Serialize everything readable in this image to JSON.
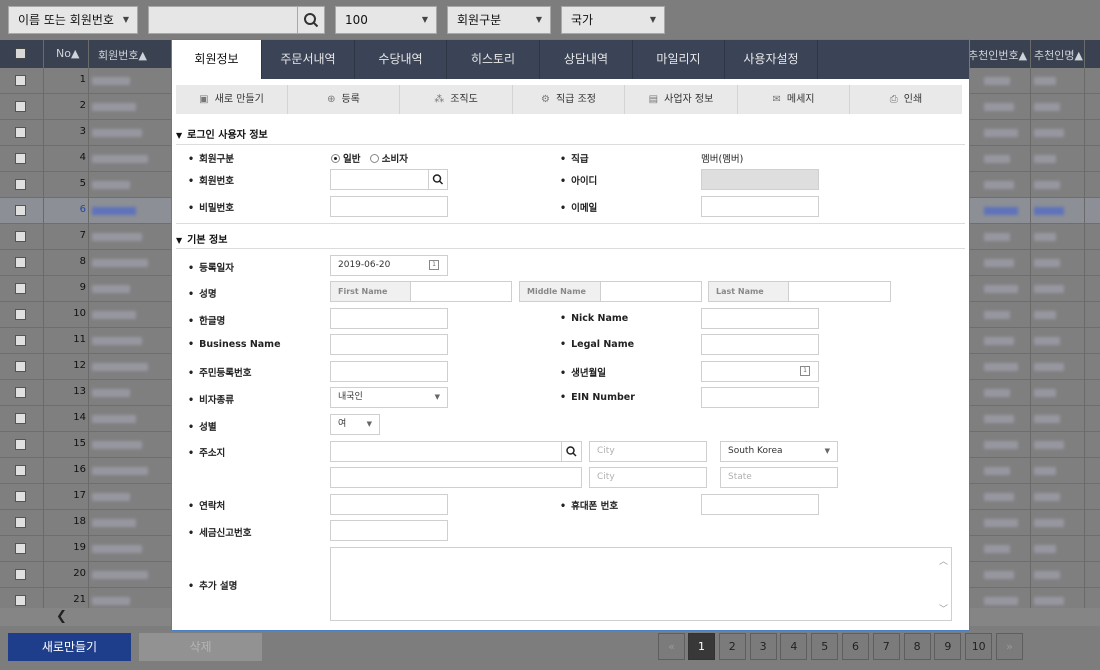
{
  "filter": {
    "search_type": "이름 또는 회원번호",
    "search_value": "",
    "page_size": "100",
    "member_type": "회원구분",
    "country": "국가"
  },
  "grid": {
    "headers": {
      "no": "No▲",
      "member_no": "회원번호▲",
      "recommender_no": "추천인번호▲",
      "recommender_name": "추천인명▲"
    },
    "rows": [
      "1",
      "2",
      "3",
      "4",
      "5",
      "6",
      "7",
      "8",
      "9",
      "10",
      "11",
      "12",
      "13",
      "14",
      "15",
      "16",
      "17",
      "18",
      "19",
      "20",
      "21"
    ],
    "selected_row": "6"
  },
  "actions": {
    "new_label": "새로만들기",
    "delete_label": "삭제"
  },
  "pagination": {
    "prev": "«",
    "next": "»",
    "pages": [
      "1",
      "2",
      "3",
      "4",
      "5",
      "6",
      "7",
      "8",
      "9",
      "10"
    ],
    "current": "1"
  },
  "modal": {
    "tabs": [
      "회원정보",
      "주문서내역",
      "수당내역",
      "히스토리",
      "상담내역",
      "마일리지",
      "사용자설정"
    ],
    "toolbar": [
      {
        "icon": "document-icon",
        "label": "새로 만들기"
      },
      {
        "icon": "plus-icon",
        "label": "등록"
      },
      {
        "icon": "org-chart-icon",
        "label": "조직도"
      },
      {
        "icon": "rank-icon",
        "label": "직급 조정"
      },
      {
        "icon": "business-icon",
        "label": "사업자 정보"
      },
      {
        "icon": "mail-icon",
        "label": "메세지"
      },
      {
        "icon": "print-icon",
        "label": "인쇄"
      }
    ],
    "login_section": {
      "title": "로그인 사용자 정보",
      "member_type_label": "회원구분",
      "radio_general": "일반",
      "radio_consumer": "소비자",
      "rank_label": "직급",
      "rank_value": "멤버(멤버)",
      "member_no_label": "회원번호",
      "id_label": "아이디",
      "password_label": "비밀번호",
      "email_label": "이메일"
    },
    "basic_section": {
      "title": "기본 정보",
      "reg_date_label": "등록일자",
      "reg_date_value": "2019-06-20",
      "name_label": "성명",
      "first_name": "First Name",
      "middle_name": "Middle Name",
      "last_name": "Last Name",
      "korean_name_label": "한글명",
      "nick_name_label": "Nick Name",
      "business_name_label": "Business Name",
      "legal_name_label": "Legal Name",
      "resident_no_label": "주민등록번호",
      "birth_label": "생년월일",
      "visa_label": "비자종류",
      "visa_value": "내국인",
      "ein_label": "EIN Number",
      "gender_label": "성별",
      "gender_value": "여",
      "address_label": "주소지",
      "city_ph": "City",
      "country_value": "South Korea",
      "state_ph": "State",
      "contact_label": "연락처",
      "mobile_label": "휴대폰 번호",
      "tax_label": "세금신고번호",
      "note_label": "추가 설명"
    }
  }
}
